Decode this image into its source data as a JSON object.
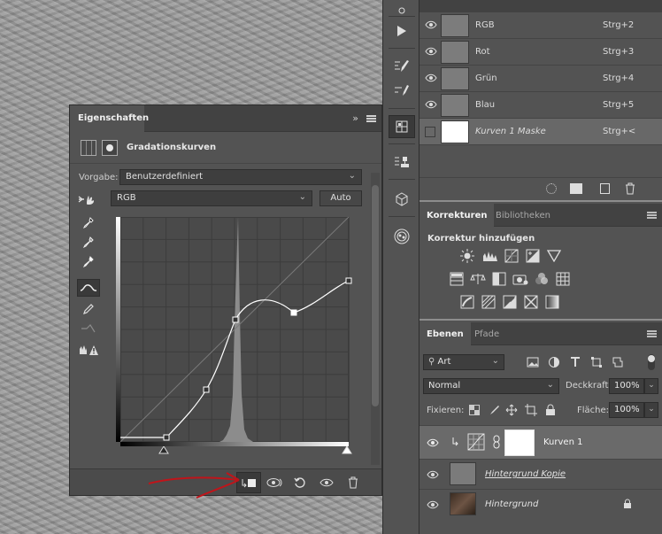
{
  "properties": {
    "tab_label": "Eigenschaften",
    "title": "Gradationskurven",
    "preset_label": "Vorgabe:",
    "preset_value": "Benutzerdefiniert",
    "channel_value": "RGB",
    "auto_label": "Auto"
  },
  "channels": [
    {
      "name": "RGB",
      "shortcut": "Strg+2"
    },
    {
      "name": "Rot",
      "shortcut": "Strg+3"
    },
    {
      "name": "Grün",
      "shortcut": "Strg+4"
    },
    {
      "name": "Blau",
      "shortcut": "Strg+5"
    },
    {
      "name": "Kurven 1 Maske",
      "shortcut": "Strg+<"
    }
  ],
  "adjustments": {
    "tab_active": "Korrekturen",
    "tab_inactive": "Bibliotheken",
    "heading": "Korrektur hinzufügen"
  },
  "layers_panel": {
    "tab_active": "Ebenen",
    "tab_inactive": "Pfade",
    "filter_kind": "Art",
    "blend_mode": "Normal",
    "opacity_label": "Deckkraft:",
    "opacity_value": "100%",
    "lock_label": "Fixieren:",
    "fill_label": "Fläche:",
    "fill_value": "100%",
    "layers": [
      {
        "name": "Kurven 1"
      },
      {
        "name": "Hintergrund Kopie"
      },
      {
        "name": "Hintergrund"
      }
    ]
  },
  "colors": {
    "panel": "#535353",
    "annotation": "#c0141a"
  }
}
